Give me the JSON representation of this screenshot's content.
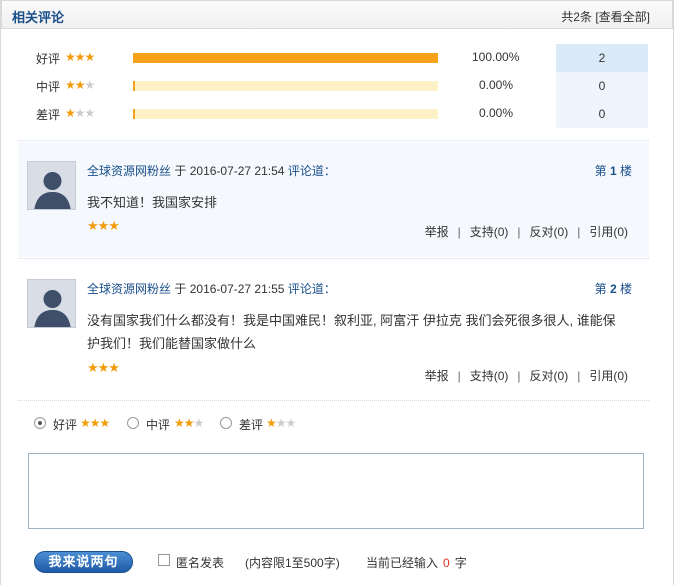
{
  "header": {
    "title": "相关评论",
    "count_text": "共2条",
    "view_all": "[查看全部]"
  },
  "colors": {
    "accent": "#1a4f8b",
    "star": "#f29c0a",
    "bar": "#f7a21b"
  },
  "stats": [
    {
      "label": "好评",
      "stars": "★★★",
      "stars_off": "",
      "fraction": 1.0,
      "percent": "100.00%",
      "count": "2"
    },
    {
      "label": "中评",
      "stars": "★★",
      "stars_off": "★",
      "fraction": 0.0,
      "percent": "0.00%",
      "count": "0"
    },
    {
      "label": "差评",
      "stars": "★",
      "stars_off": "★★",
      "fraction": 0.0,
      "percent": "0.00%",
      "count": "0"
    }
  ],
  "comments": [
    {
      "user": "全球资源网粉丝",
      "at": "于",
      "time": "2016-07-27 21:54",
      "verb": "评论道：",
      "floor_pre": "第",
      "floor_num": "1",
      "floor_post": "楼",
      "text": "我不知道！我国家安排",
      "stars": "★★★",
      "report": "举报",
      "support": "支持(0)",
      "oppose": "反对(0)",
      "quote": "引用(0)"
    },
    {
      "user": "全球资源网粉丝",
      "at": "于",
      "time": "2016-07-27 21:55",
      "verb": "评论道：",
      "floor_pre": "第",
      "floor_num": "2",
      "floor_post": "楼",
      "text": "没有国家我们什么都没有！我是中国难民！叙利亚, 阿富汗 伊拉克 我们会死很多很人, 谁能保护我们！我们能替国家做什么",
      "stars": "★★★",
      "report": "举报",
      "support": "支持(0)",
      "oppose": "反对(0)",
      "quote": "引用(0)"
    }
  ],
  "rating_form": {
    "options": [
      {
        "label": "好评",
        "stars": "★★★",
        "stars_off": "",
        "checked": true
      },
      {
        "label": "中评",
        "stars": "★★",
        "stars_off": "★",
        "checked": false
      },
      {
        "label": "差评",
        "stars": "★",
        "stars_off": "★★",
        "checked": false
      }
    ],
    "textarea_value": ""
  },
  "footer": {
    "submit_label": "我来说两句",
    "anonymous_label": "匿名发表",
    "limit_text": "(内容限1至500字)",
    "typed_pre": "当前已经输入",
    "typed_count": "0",
    "typed_post": "字"
  }
}
